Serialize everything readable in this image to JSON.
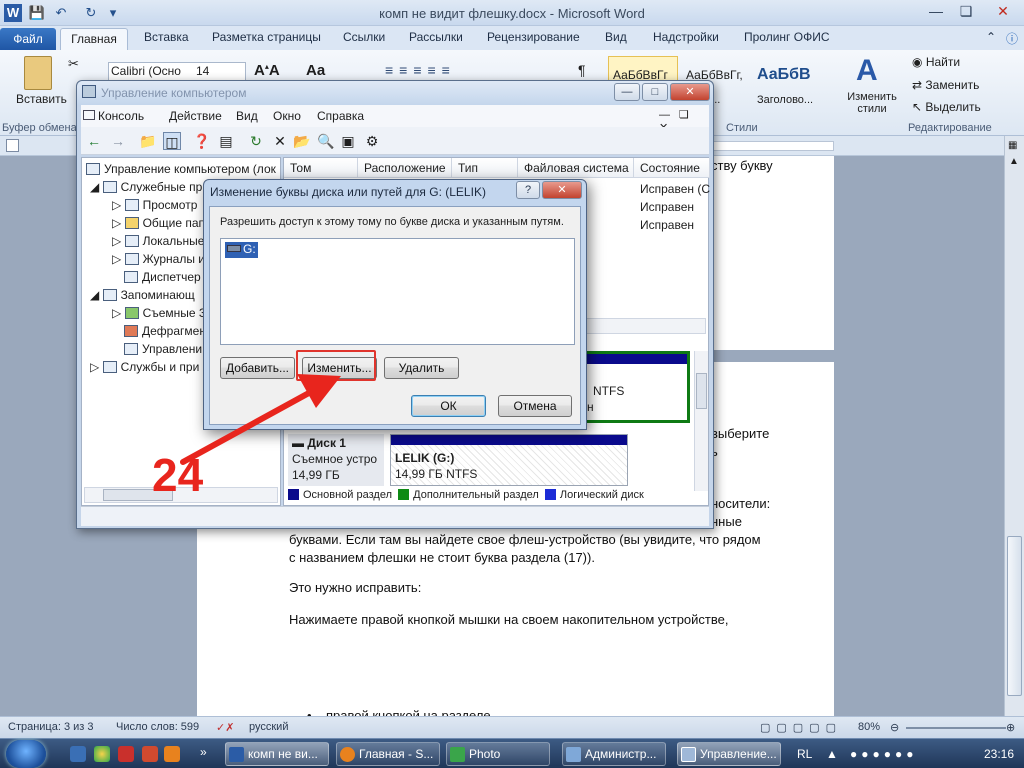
{
  "word": {
    "title": "комп не видит флешку.docx - Microsoft Word",
    "tabs": [
      "Файл",
      "Главная",
      "Вставка",
      "Разметка страницы",
      "Ссылки",
      "Рассылки",
      "Рецензирование",
      "Вид",
      "Надстройки",
      "Пролинг ОФИС"
    ],
    "ribbon": {
      "paste": "Вставить",
      "clipboard_group": "Буфер обмена",
      "font_name": "Calibri (Осно",
      "font_size": "14",
      "styles": [
        "АаБбВвГг",
        "АаБбВвГг,",
        "АаБбВ"
      ],
      "style_names": [
        "",
        "Интe...",
        "Заголово..."
      ],
      "change_styles": "Изменить стили",
      "styles_group": "Стили",
      "find": "Найти",
      "replace": "Заменить",
      "select": "Выделить",
      "editing_group": "Редактирование"
    },
    "doc": {
      "top_fragment": "ству букву",
      "right_frag1": "выберите",
      "right_frag2": "ь",
      "right_frag3": "носители:",
      "right_frag4": "нные",
      "line1": "буквами. Если там вы найдете свое флеш-устройство (вы увидите, что рядом",
      "line2": "с названием флешки не стоит буква раздела (17)).",
      "line3": "Это нужно исправить:",
      "line4": "Нажимаете правой кнопкой мышки на своем накопительном устройстве,",
      "bullet": "правой кнопкой на разделе"
    },
    "status": {
      "page": "Страница: 3 из 3",
      "words": "Число слов: 599",
      "lang": "русский",
      "zoom": "80%"
    }
  },
  "cm": {
    "title": "Управление компьютером",
    "menu": [
      "Консоль",
      "Действие",
      "Вид",
      "Окно",
      "Справка"
    ],
    "tree": [
      "Управление компьютером (лок",
      "Служебные пр",
      "Просмотр",
      "Общие пап",
      "Локальные",
      "Журналы и",
      "Диспетчер",
      "Запоминающ",
      "Съемные З",
      "Дефрагмент",
      "Управлени",
      "Службы и при"
    ],
    "columns": [
      "Том",
      "Расположение",
      "Тип",
      "Файловая система",
      "Состояние"
    ],
    "rows_status": [
      "Исправен (С",
      "Исправен",
      "Исправен"
    ],
    "disk_partial": {
      "fs": "NTFS",
      "state": "н"
    },
    "disk1": {
      "name": "Диск 1",
      "type": "Съемное устро",
      "size": "14,99 ГБ"
    },
    "partition": {
      "name": "LELIK  (G:)",
      "detail": "14,99 ГБ NTFS"
    },
    "legend": [
      "Основной раздел",
      "Дополнительный раздел",
      "Логический диск"
    ],
    "legend_colors": [
      "#0a0a8c",
      "#0e8a14",
      "#1b2bd6"
    ]
  },
  "dialog": {
    "title": "Изменение буквы диска или путей для G: (LELIK)",
    "prompt": "Разрешить доступ к этому тому по букве диска и указанным путям.",
    "list_item": "G:",
    "add": "Добавить...",
    "change": "Изменить...",
    "remove": "Удалить",
    "ok": "ОК",
    "cancel": "Отмена"
  },
  "annotation": {
    "label": "24",
    "color": "#e8251d"
  },
  "taskbar": {
    "items": [
      "комп не ви...",
      "Главная - S...",
      "Photo",
      "Администр...",
      "Управление..."
    ],
    "lang": "RL",
    "time": "23:16"
  }
}
